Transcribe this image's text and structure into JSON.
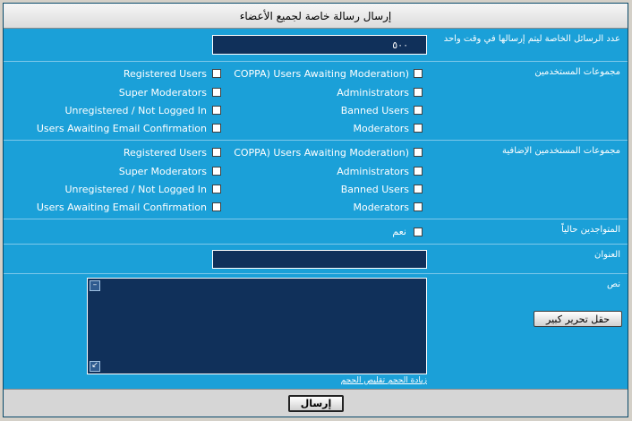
{
  "title": "إرسال رسالة خاصة لجميع الأعضاء",
  "batch": {
    "label": "عدد الرسائل الخاصة ليتم إرسالها في وقت واحد",
    "value": "٥٠٠"
  },
  "groups": {
    "label": "مجموعات المستخدمين",
    "left": [
      "Registered Users",
      "Super Moderators",
      "Unregistered / Not Logged In",
      "Users Awaiting Email Confirmation"
    ],
    "right": [
      "COPPA) Users Awaiting Moderation)",
      "Administrators",
      "Banned Users",
      "Moderators"
    ]
  },
  "extra_groups": {
    "label": "مجموعات المستخدمين الإضافية",
    "left": [
      "Registered Users",
      "Super Moderators",
      "Unregistered / Not Logged In",
      "Users Awaiting Email Confirmation"
    ],
    "right": [
      "COPPA) Users Awaiting Moderation)",
      "Administrators",
      "Banned Users",
      "Moderators"
    ]
  },
  "online": {
    "label": "المتواجدين حالياً",
    "option": "نعم"
  },
  "subject": {
    "label": "العنوان",
    "value": ""
  },
  "message": {
    "label": "نص",
    "value": "",
    "editor_button": "حقل تحرير كبير",
    "increase_link": "زيادة الحجم",
    "decrease_link": "تقليص الحجم",
    "top_handle": "–",
    "bottom_handle": "↙"
  },
  "submit": "إرسال"
}
